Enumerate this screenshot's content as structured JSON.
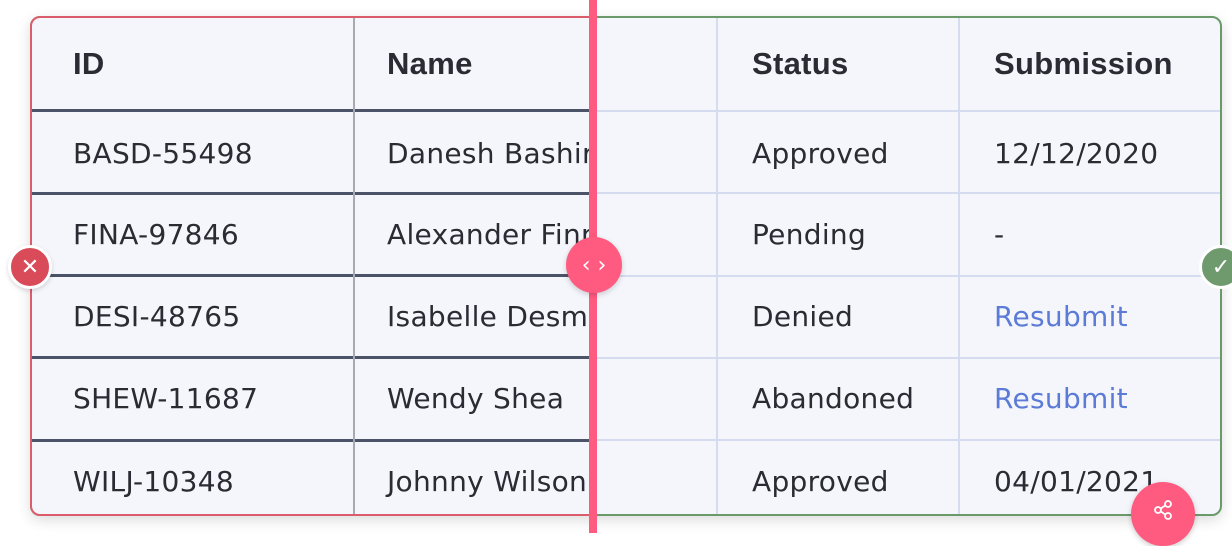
{
  "table": {
    "headers": {
      "id": "ID",
      "name": "Name",
      "status": "Status",
      "submission": "Submission"
    },
    "rows": [
      {
        "id": "BASD-55498",
        "name": "Danesh Bashir",
        "status": "Approved",
        "submission": "12/12/2020"
      },
      {
        "id": "FINA-97846",
        "name": "Alexander Finn",
        "status": "Pending",
        "submission": "-"
      },
      {
        "id": "DESI-48765",
        "name": "Isabelle Desmarais",
        "status": "Denied",
        "submission": "Resubmit"
      },
      {
        "id": "SHEW-11687",
        "name": "Wendy Shea",
        "status": "Abandoned",
        "submission": "Resubmit"
      },
      {
        "id": "WILJ-10348",
        "name": "Johnny Wilson",
        "status": "Approved",
        "submission": "04/01/2021"
      }
    ]
  },
  "icons": {
    "handle": "arrows-left-right-icon",
    "reject": "close-icon",
    "accept": "check-icon",
    "share": "share-icon"
  },
  "colors": {
    "accent": "#ff5a7f",
    "reject_border": "#db5c6a",
    "accept_border": "#6a9a6a",
    "link": "#5b7bd6"
  }
}
